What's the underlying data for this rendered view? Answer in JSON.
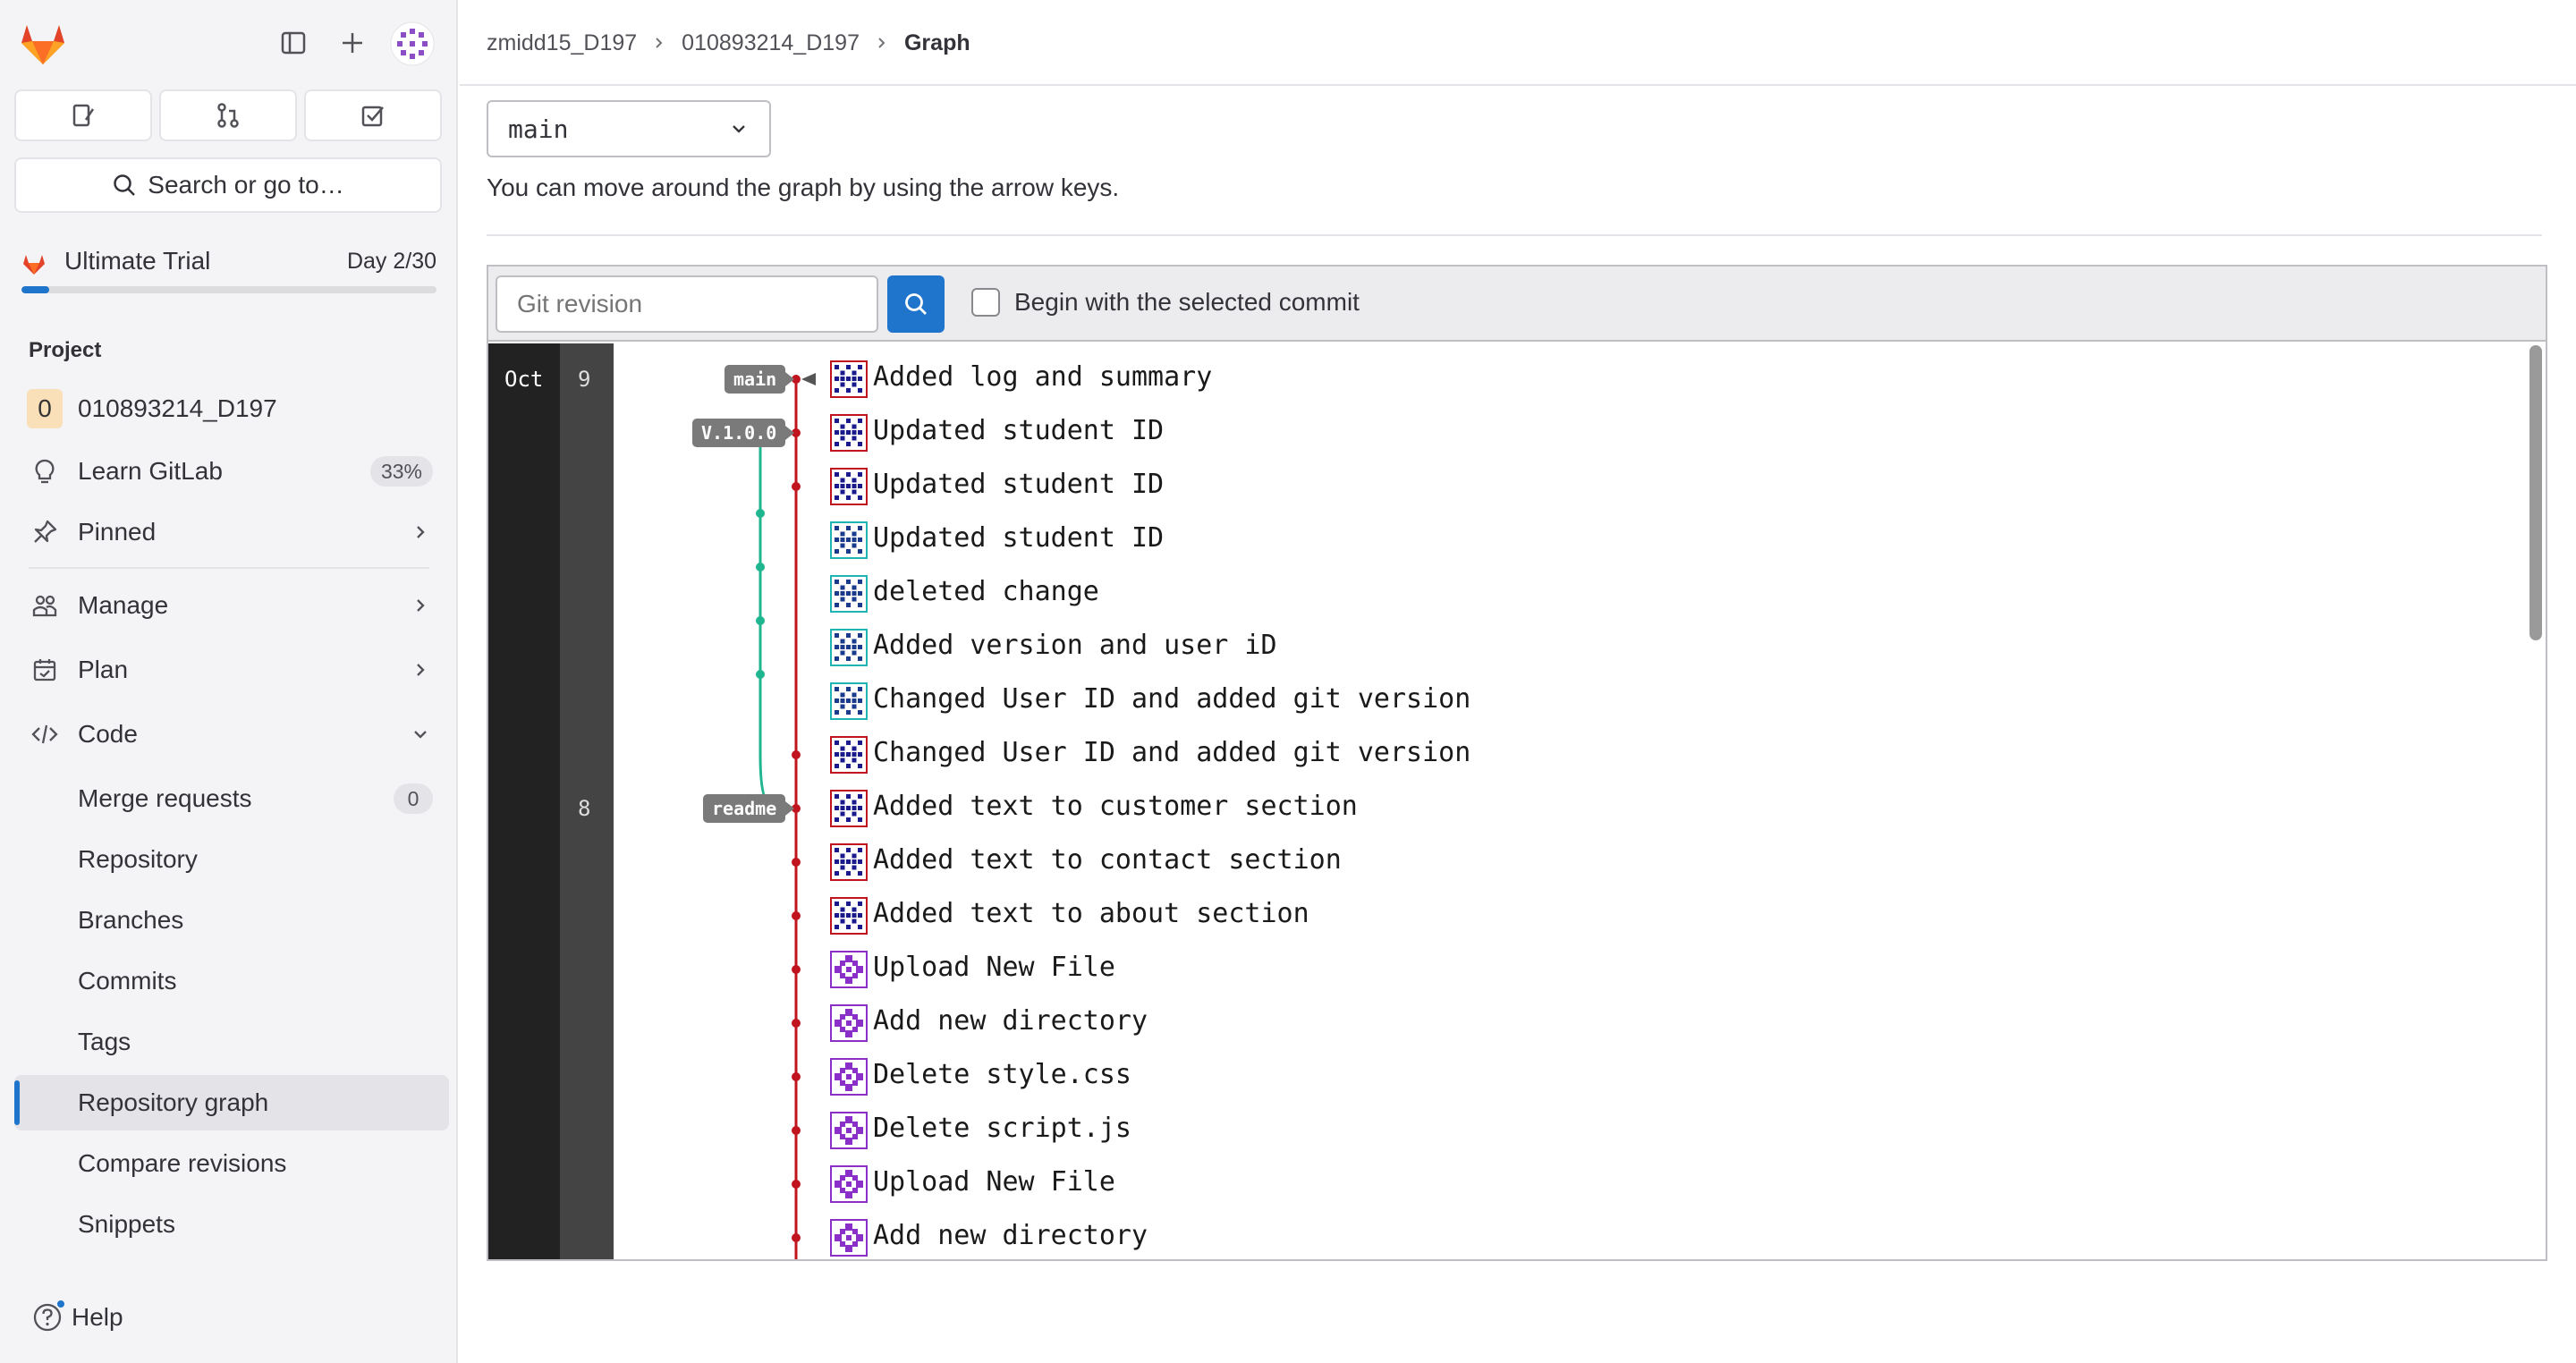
{
  "sidebar": {
    "trial": {
      "label": "Ultimate Trial",
      "day": "Day 2/30",
      "progress": 0.067
    },
    "section_title": "Project",
    "project": {
      "badge": "0",
      "name": "010893214_D197"
    },
    "learn": {
      "label": "Learn GitLab",
      "percent": "33%"
    },
    "pinned": {
      "label": "Pinned"
    },
    "manage": {
      "label": "Manage"
    },
    "plan": {
      "label": "Plan"
    },
    "code": {
      "label": "Code"
    },
    "code_items": [
      {
        "label": "Merge requests",
        "count": "0"
      },
      {
        "label": "Repository"
      },
      {
        "label": "Branches"
      },
      {
        "label": "Commits"
      },
      {
        "label": "Tags"
      },
      {
        "label": "Repository graph"
      },
      {
        "label": "Compare revisions"
      },
      {
        "label": "Snippets"
      }
    ],
    "search_label": "Search or go to…",
    "help_label": "Help"
  },
  "breadcrumb": [
    "zmidd15_D197",
    "010893214_D197",
    "Graph"
  ],
  "branch_select": {
    "value": "main"
  },
  "hint": "You can move around the graph by using the arrow keys.",
  "toolbar": {
    "revision_placeholder": "Git revision",
    "begin_label": "Begin with the selected commit"
  },
  "graph": {
    "month": "Oct",
    "days": [
      {
        "label": "9",
        "row": 0
      },
      {
        "label": "8",
        "row": 8
      }
    ],
    "refs": [
      {
        "label": "main",
        "row": 0
      },
      {
        "label": "V.1.0.0",
        "row": 1
      },
      {
        "label": "readme",
        "row": 8
      }
    ],
    "commits": [
      {
        "message": "Added log and summary",
        "avatar": "a"
      },
      {
        "message": "Updated student ID",
        "avatar": "a"
      },
      {
        "message": "Updated student ID",
        "avatar": "a"
      },
      {
        "message": "Updated student ID",
        "avatar": "b"
      },
      {
        "message": "deleted change",
        "avatar": "b"
      },
      {
        "message": "Added version and user iD",
        "avatar": "b"
      },
      {
        "message": "Changed User ID and added git version",
        "avatar": "b"
      },
      {
        "message": "Changed User ID and added git version",
        "avatar": "a"
      },
      {
        "message": "Added text to customer section",
        "avatar": "a"
      },
      {
        "message": "Added text to contact section",
        "avatar": "a"
      },
      {
        "message": "Added text to about section",
        "avatar": "a"
      },
      {
        "message": "Upload New File",
        "avatar": "c"
      },
      {
        "message": "Add new directory",
        "avatar": "c"
      },
      {
        "message": "Delete style.css",
        "avatar": "c"
      },
      {
        "message": "Delete script.js",
        "avatar": "c"
      },
      {
        "message": "Upload New File",
        "avatar": "c"
      },
      {
        "message": "Add new directory",
        "avatar": "c"
      }
    ],
    "colors": {
      "main_line": "#c0141e",
      "branch_line": "#1fb58f"
    }
  }
}
